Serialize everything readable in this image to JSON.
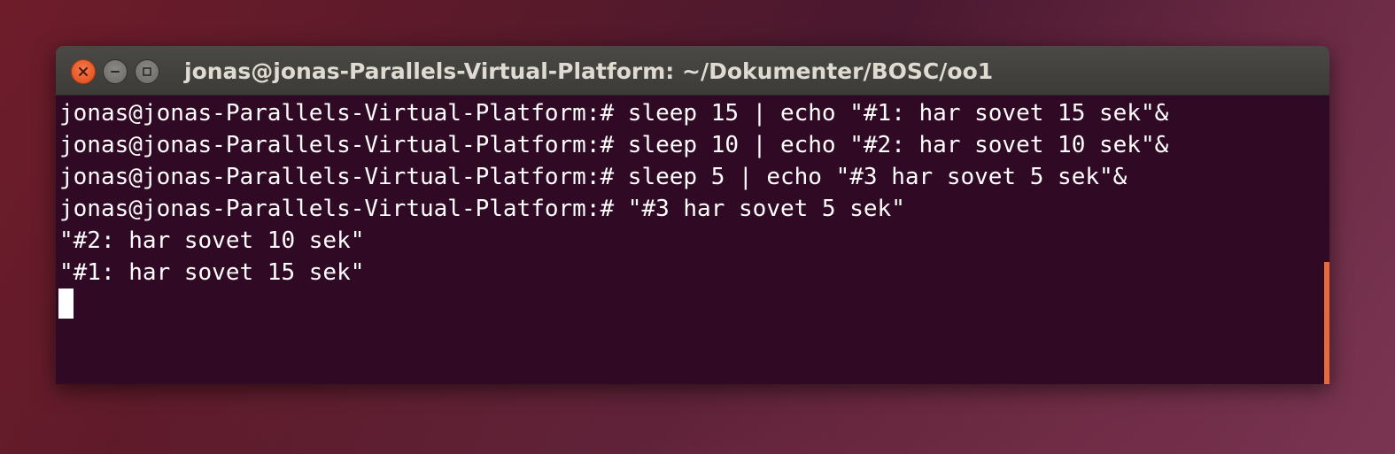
{
  "window": {
    "title": "jonas@jonas-Parallels-Virtual-Platform: ~/Dokumenter/BOSC/oo1",
    "controls": {
      "close_icon": "close-icon",
      "minimize_icon": "minimize-icon",
      "maximize_icon": "maximize-icon"
    }
  },
  "terminal": {
    "lines": [
      "jonas@jonas-Parallels-Virtual-Platform:# sleep 15 | echo \"#1: har sovet 15 sek\"&",
      "jonas@jonas-Parallels-Virtual-Platform:# sleep 10 | echo \"#2: har sovet 10 sek\"&",
      "jonas@jonas-Parallels-Virtual-Platform:# sleep 5 | echo \"#3 har sovet 5 sek\"&",
      "jonas@jonas-Parallels-Virtual-Platform:# \"#3 har sovet 5 sek\"",
      "\"#2: har sovet 10 sek\"",
      "\"#1: har sovet 15 sek\""
    ],
    "colors": {
      "background": "#300a24",
      "text": "#ffffff",
      "scrollbar": "#e66a3a"
    }
  }
}
